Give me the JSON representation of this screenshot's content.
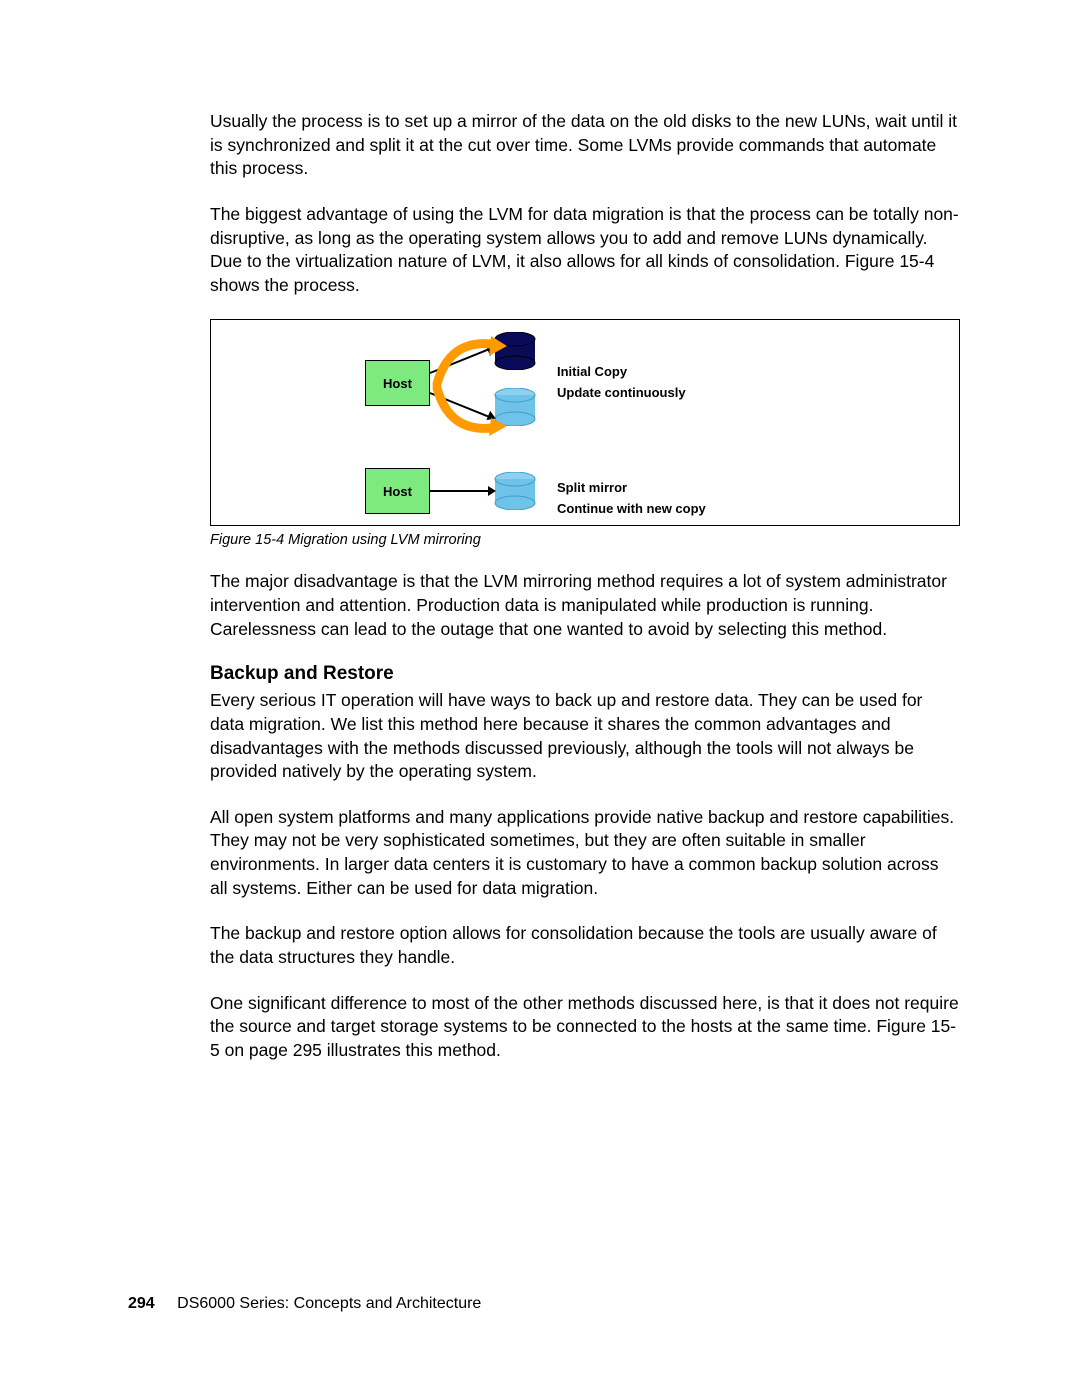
{
  "paragraphs": {
    "p1": "Usually the process is to set up a mirror of the data on the old disks to the new LUNs, wait until it is synchronized and split it at the cut over time. Some LVMs provide commands that automate this process.",
    "p2": "The biggest advantage of using the LVM for data migration is that the process can be totally non-disruptive, as long as the operating system allows you to add and remove LUNs dynamically. Due to the virtualization nature of LVM, it also allows for all kinds of consolidation. Figure 15-4 shows the process.",
    "p3": "The major disadvantage is that the LVM mirroring method requires a lot of system administrator intervention and attention. Production data is manipulated while production is running. Carelessness can lead to the outage that one wanted to avoid by selecting this method.",
    "p4": "Every serious IT operation will have ways to back up and restore data. They can be used for data migration. We list this method here because it shares the common advantages and disadvantages with the methods discussed previously, although the tools will not always be provided natively by the operating system.",
    "p5": "All open system platforms and many applications provide native backup and restore capabilities. They may not be very sophisticated sometimes, but they are often suitable in smaller environments. In larger data centers it is customary to have a common backup solution across all systems. Either can be used for data migration.",
    "p6": "The backup and restore option allows for consolidation because the tools are usually aware of the data structures they handle.",
    "p7": "One significant difference to most of the other methods discussed here, is that it does not require the source and target storage systems to be connected to the hosts at the same time. Figure 15-5 on page 295 illustrates this method."
  },
  "figure": {
    "host_label": "Host",
    "top_text_line1": "Initial Copy",
    "top_text_line2": "Update continuously",
    "bottom_text_line1": "Split mirror",
    "bottom_text_line2": "Continue with new copy",
    "caption": "Figure 15-4   Migration using LVM mirroring"
  },
  "heading": "Backup and Restore",
  "footer": {
    "page_number": "294",
    "book_title": "DS6000 Series: Concepts and Architecture"
  }
}
